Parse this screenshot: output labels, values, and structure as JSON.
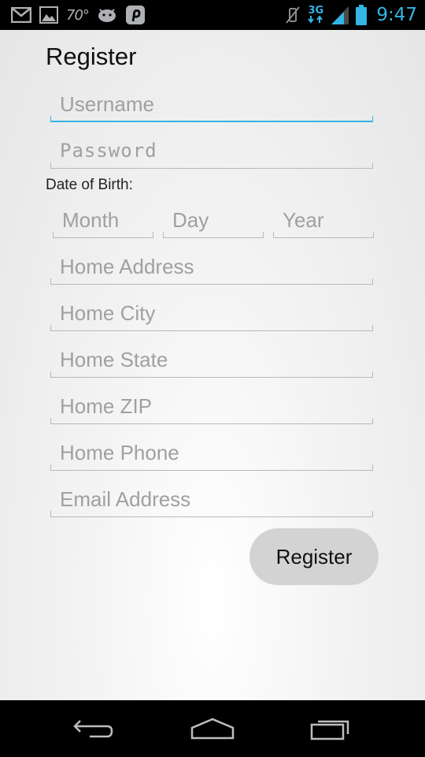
{
  "status_bar": {
    "left_icons": [
      "gmail-icon",
      "gallery-icon",
      "weather-temp",
      "android-icon",
      "pinterest-icon"
    ],
    "temperature": "70°",
    "network": "3G",
    "time": "9:47",
    "accent": "#33b5e5"
  },
  "form": {
    "title": "Register",
    "username_placeholder": "Username",
    "password_placeholder": "Password",
    "dob_label": "Date of Birth:",
    "month_placeholder": "Month",
    "day_placeholder": "Day",
    "year_placeholder": "Year",
    "address_placeholder": "Home Address",
    "city_placeholder": "Home City",
    "state_placeholder": "Home State",
    "zip_placeholder": "Home ZIP",
    "phone_placeholder": "Home Phone",
    "email_placeholder": "Email Address",
    "register_label": "Register"
  },
  "nav_bar": {
    "icons": [
      "back-icon",
      "home-icon",
      "recent-apps-icon"
    ]
  }
}
